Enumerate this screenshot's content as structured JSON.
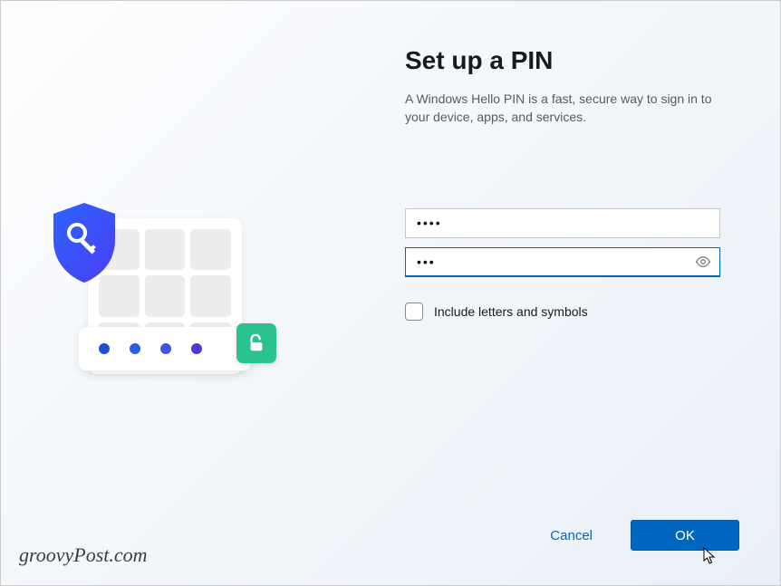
{
  "dialog": {
    "title": "Set up a PIN",
    "subtitle": "A Windows Hello PIN is a fast, secure way to sign in to your device, apps, and services.",
    "pin_value": "••••",
    "confirm_value": "•••",
    "checkbox_label": "Include letters and symbols",
    "checkbox_checked": false,
    "cancel_label": "Cancel",
    "ok_label": "OK"
  },
  "icons": {
    "shield": "shield-key-icon",
    "reveal": "eye-reveal-icon",
    "lock": "unlock-icon"
  },
  "colors": {
    "accent": "#0067c0",
    "shield_gradient_start": "#2b63ff",
    "shield_gradient_end": "#4b3ff0",
    "lock_badge": "#2ac28e"
  },
  "watermark": "groovyPost.com"
}
